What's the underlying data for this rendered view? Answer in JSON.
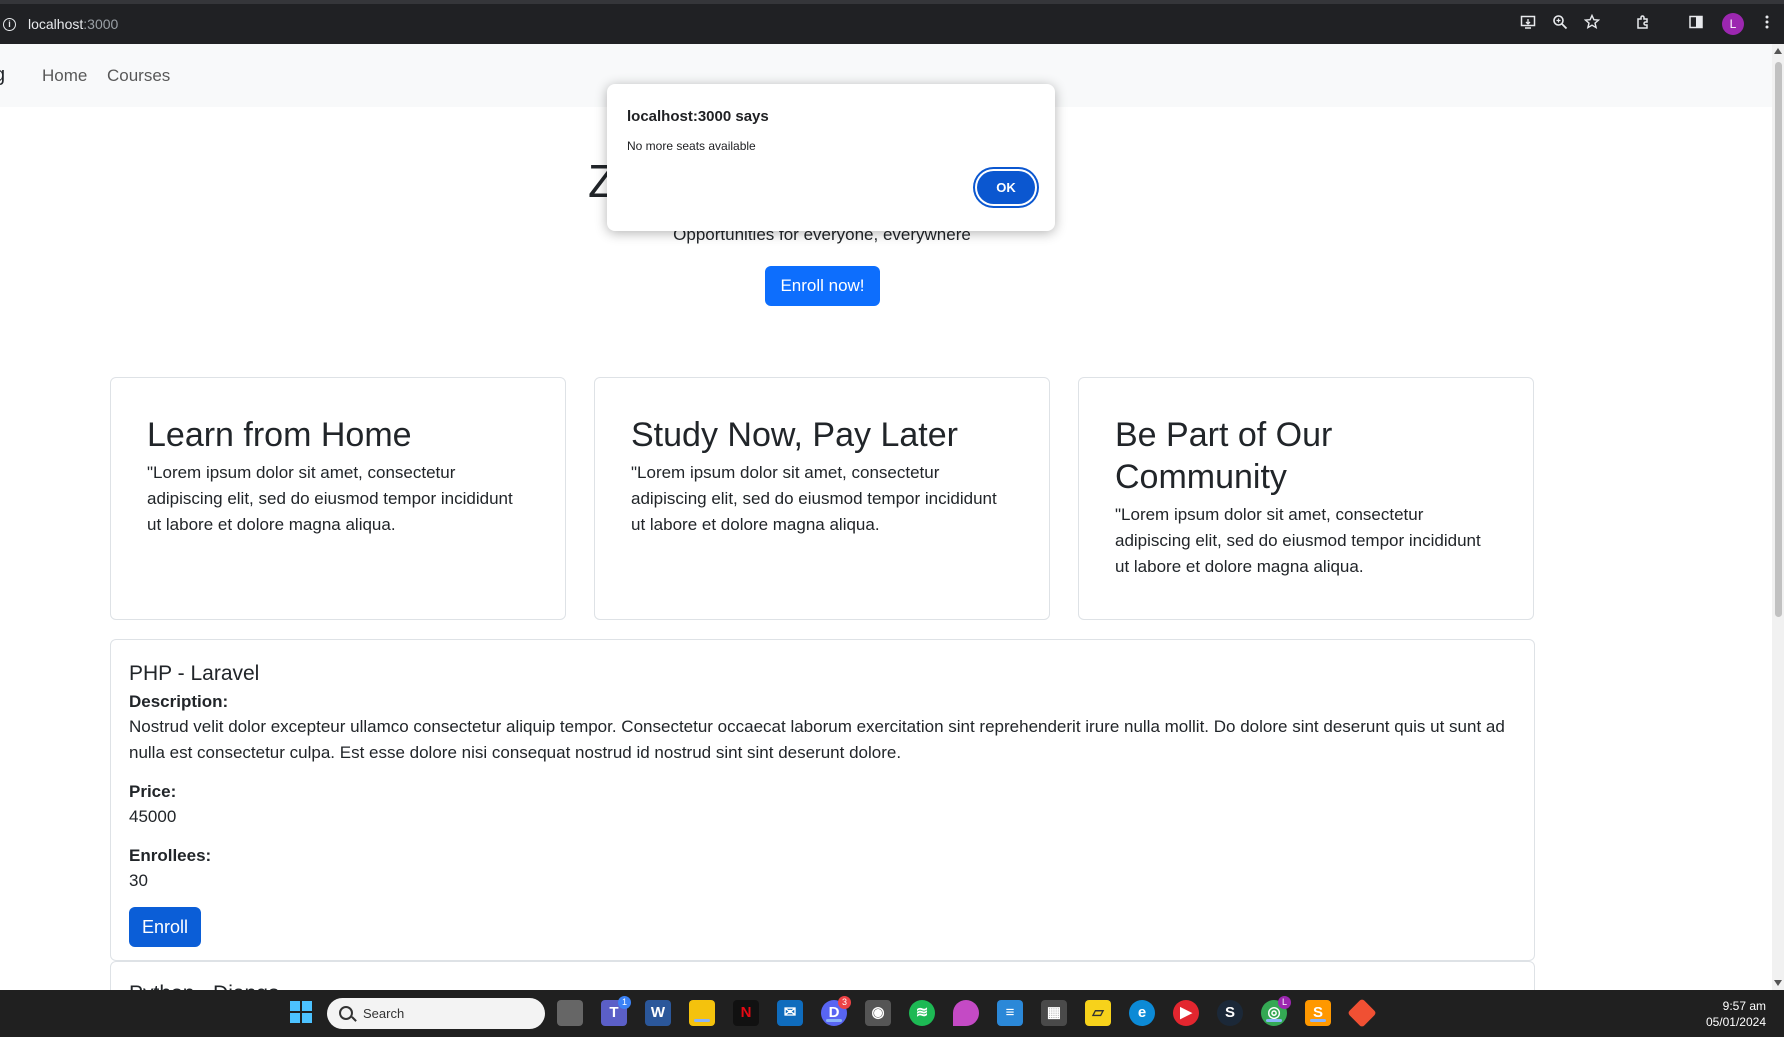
{
  "browser": {
    "url_host": "localhost",
    "url_port": ":3000",
    "profile_initial": "L",
    "icons": [
      "cast-icon",
      "zoom-icon",
      "star-icon",
      "extensions-icon",
      "sidepanel-icon",
      "menu-icon"
    ]
  },
  "navbar": {
    "brand": "g",
    "links": [
      "Home",
      "Courses"
    ]
  },
  "hero": {
    "title": "Zuitt Coding Bootcamp",
    "subtitle": "Opportunities for everyone, everywhere",
    "button": "Enroll now!"
  },
  "highlights": [
    {
      "title": "Learn from Home",
      "text": "\"Lorem ipsum dolor sit amet, consectetur adipiscing elit, sed do eiusmod tempor incididunt ut labore et dolore magna aliqua."
    },
    {
      "title": "Study Now, Pay Later",
      "text": "\"Lorem ipsum dolor sit amet, consectetur adipiscing elit, sed do eiusmod tempor incididunt ut labore et dolore magna aliqua."
    },
    {
      "title": "Be Part of Our Community",
      "text": "\"Lorem ipsum dolor sit amet, consectetur adipiscing elit, sed do eiusmod tempor incididunt ut labore et dolore magna aliqua."
    }
  ],
  "course": {
    "name": "PHP - Laravel",
    "description_label": "Description:",
    "description": "Nostrud velit dolor excepteur ullamco consectetur aliquip tempor. Consectetur occaecat laborum exercitation sint reprehenderit irure nulla mollit. Do dolore sint deserunt quis ut sunt ad nulla est consectetur culpa. Est esse dolore nisi consequat nostrud id nostrud sint sint deserunt dolore.",
    "price_label": "Price:",
    "price": "45000",
    "enrollees_label": "Enrollees:",
    "enrollees": "30",
    "button": "Enroll"
  },
  "course2": {
    "name": "Python - Django"
  },
  "dialog": {
    "title": "localhost:3000 says",
    "message": "No more seats available",
    "ok": "OK"
  },
  "taskbar": {
    "search_placeholder": "Search",
    "time": "9:57 am",
    "date": "05/01/2024",
    "teams_badge": "1",
    "discord_badge": "3",
    "chrome_badge": "L"
  },
  "colors": {
    "primary": "#0d6efd",
    "dialog_button": "#0b57d0",
    "chrome_bg": "#202124",
    "taskbar_bg": "#202020"
  }
}
